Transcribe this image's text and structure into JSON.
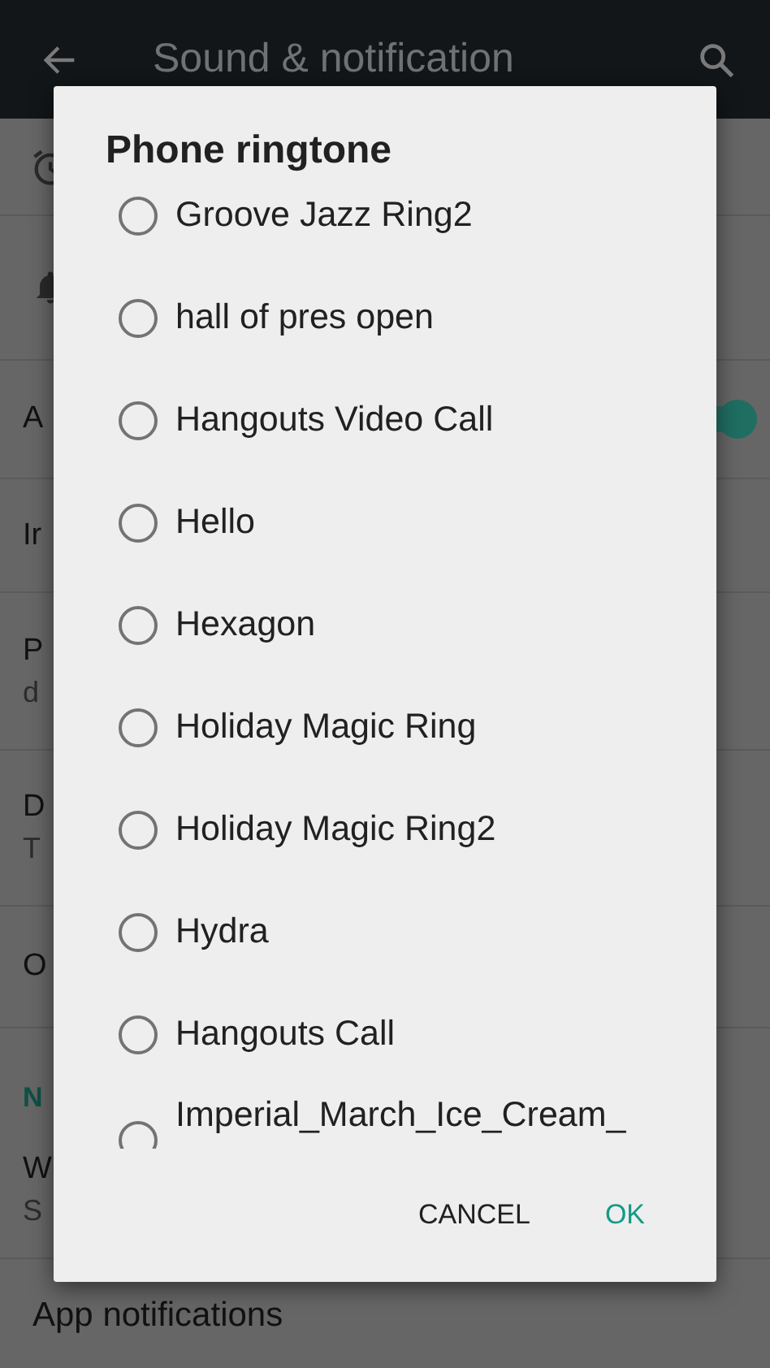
{
  "app_bar": {
    "title": "Sound & notification"
  },
  "settings": [
    {
      "kind": "alarm"
    },
    {
      "kind": "bell"
    },
    {
      "kind": "switch",
      "title": "A",
      "on": true
    },
    {
      "kind": "item",
      "title": "Ir"
    },
    {
      "kind": "item",
      "title": "P",
      "summary": "d"
    },
    {
      "kind": "item",
      "title": "D",
      "summary": "T"
    },
    {
      "kind": "item",
      "title": "O"
    },
    {
      "kind": "header",
      "title": "N"
    },
    {
      "kind": "item",
      "title": "W",
      "summary": "S"
    },
    {
      "kind": "item",
      "title": "App notifications"
    }
  ],
  "dialog": {
    "title": "Phone ringtone",
    "options": [
      {
        "label": "Groove Jazz Ring2",
        "selected": false
      },
      {
        "label": "hall of pres open",
        "selected": false
      },
      {
        "label": "Hangouts Video Call",
        "selected": false
      },
      {
        "label": "Hello",
        "selected": false
      },
      {
        "label": "Hexagon",
        "selected": false
      },
      {
        "label": "Holiday Magic Ring",
        "selected": false
      },
      {
        "label": "Holiday Magic Ring2",
        "selected": false
      },
      {
        "label": "Hydra",
        "selected": false
      },
      {
        "label": "Hangouts Call",
        "selected": false
      },
      {
        "label": "Imperial_March_Ice_Cream_",
        "selected": false
      }
    ],
    "buttons": [
      {
        "label": "CANCEL",
        "kind": "neutral"
      },
      {
        "label": "OK",
        "kind": "primary"
      }
    ]
  }
}
